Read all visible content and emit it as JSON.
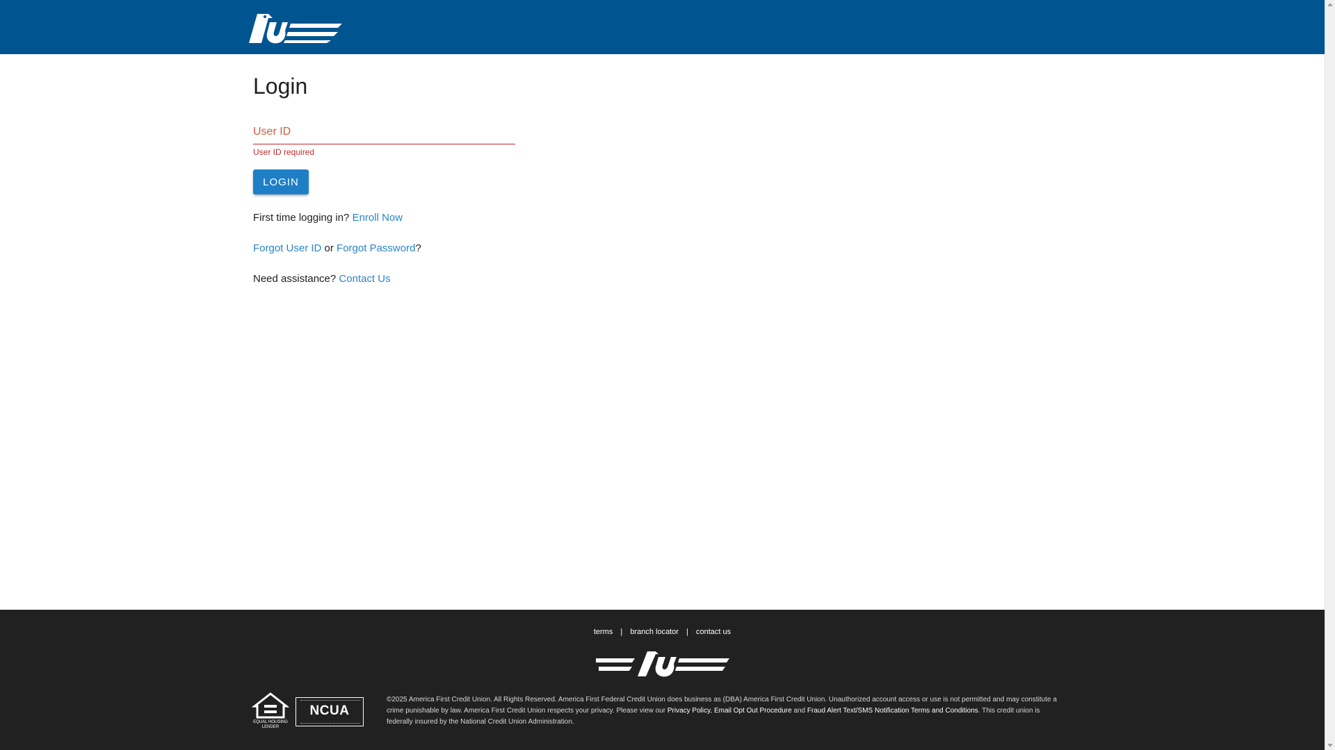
{
  "header": {
    "logo_icon": "brand-logo-icon"
  },
  "page": {
    "title": "Login"
  },
  "form": {
    "userid_label": "User ID",
    "userid_value": "",
    "userid_error": "User ID required",
    "login_label": "LOGIN"
  },
  "links": {
    "enroll_prompt": "First time logging in?",
    "enroll_link": "Enroll Now",
    "forgot_userid": "Forgot User ID",
    "or_text": "or",
    "forgot_password": "Forgot Password",
    "question_mark": "?",
    "help_prompt": "Need assistance?",
    "contact_link": "Contact Us"
  },
  "footer": {
    "links": [
      "terms",
      "branch locator",
      "contact us"
    ],
    "separator": "|",
    "ehl_label": "EQUAL HOUSING LENDER",
    "ncua_label": "NCUA",
    "legal_text_1": "©2025 America First Credit Union. All Rights Reserved. America First Federal Credit Union does business as (DBA) America First Credit Union. Unauthorized account access or use is not permitted and may constitute a crime punishable by law. America First Credit Union respects your privacy. Please view our",
    "privacy_policy": "Privacy Policy",
    "comma": ",",
    "email_opt_out": "Email Opt Out Procedure",
    "and_text": "and",
    "fraud_alert": "Fraud Alert Text/SMS Notification Terms and Conditions",
    "legal_text_2": ". This credit union is federally insured by the National Credit Union Administration."
  },
  "colors": {
    "header_bg": "#005490",
    "footer_bg": "#212121",
    "button_bg": "#1e7fc6",
    "link": "#2b84c9",
    "error": "#c62828"
  }
}
